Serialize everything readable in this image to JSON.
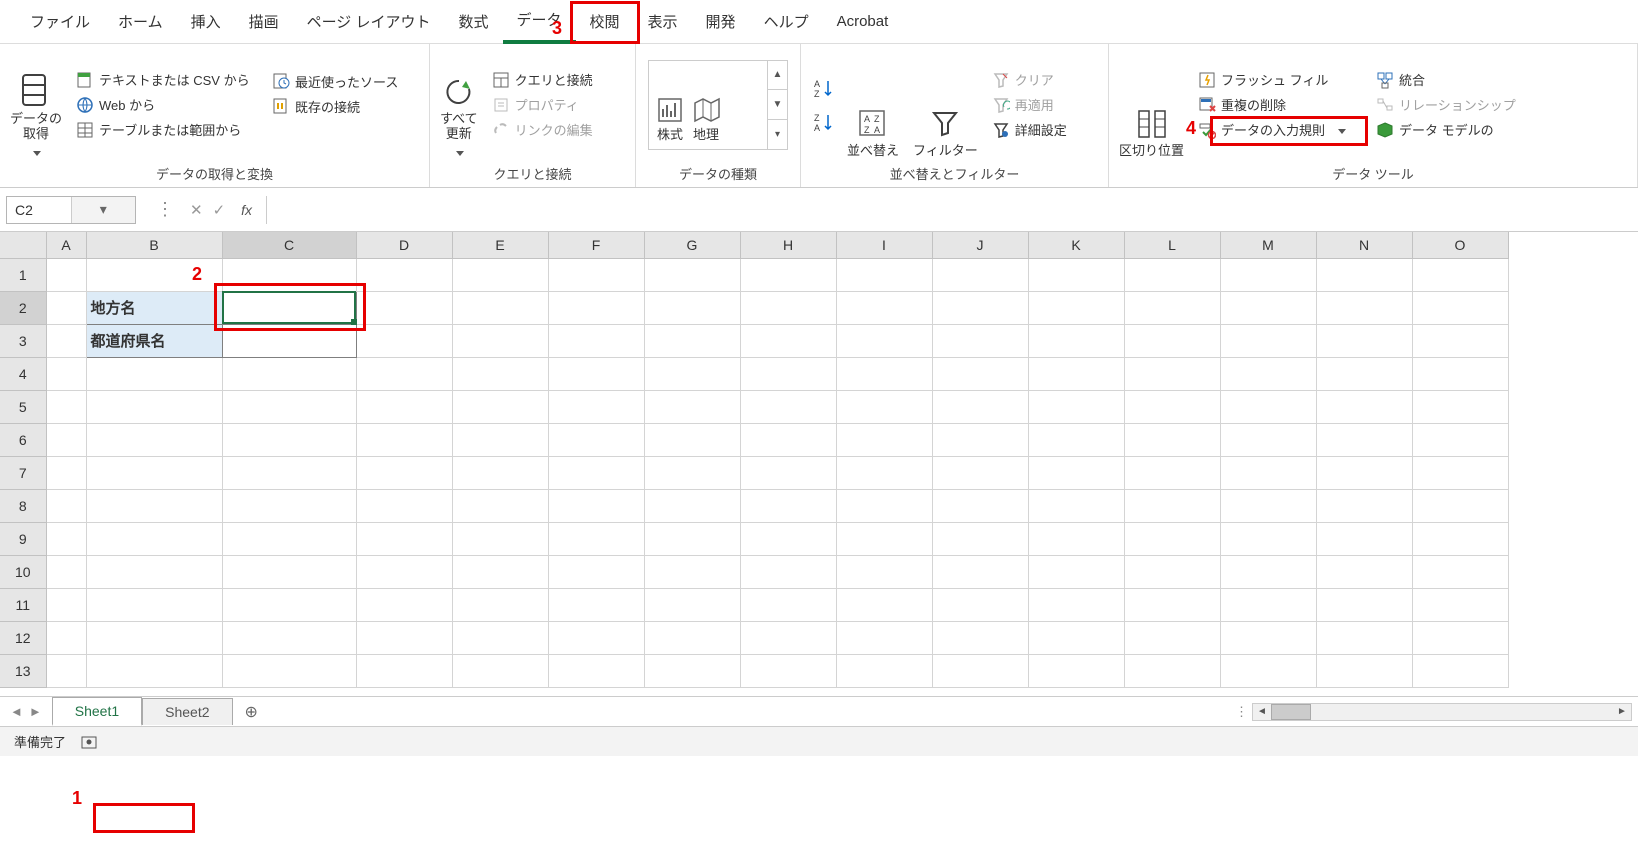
{
  "menu": [
    "ファイル",
    "ホーム",
    "挿入",
    "描画",
    "ページ レイアウト",
    "数式",
    "データ",
    "校閲",
    "表示",
    "開発",
    "ヘルプ",
    "Acrobat"
  ],
  "active_menu_index": 6,
  "ribbon": {
    "group1": {
      "label": "データの取得と変換",
      "data_get": "データの\n取得",
      "from_csv": "テキストまたは CSV から",
      "from_web": "Web から",
      "from_table": "テーブルまたは範囲から",
      "recent": "最近使ったソース",
      "existing": "既存の接続"
    },
    "group2": {
      "label": "クエリと接続",
      "refresh": "すべて\n更新",
      "queries": "クエリと接続",
      "properties": "プロパティ",
      "edit_links": "リンクの編集"
    },
    "group3": {
      "label": "データの種類",
      "stocks": "株式",
      "geo": "地理"
    },
    "group4": {
      "label": "並べ替えとフィルター",
      "sort": "並べ替え",
      "filter": "フィルター",
      "clear": "クリア",
      "reapply": "再適用",
      "advanced": "詳細設定"
    },
    "group5": {
      "label": "データ ツール",
      "text_to_col": "区切り位置",
      "flash_fill": "フラッシュ フィル",
      "remove_dup": "重複の削除",
      "validation": "データの入力規則",
      "consolidate": "統合",
      "relationships": "リレーションシップ",
      "data_model": "データ モデルの"
    }
  },
  "name_box": "C2",
  "fx_label": "fx",
  "columns": [
    "A",
    "B",
    "C",
    "D",
    "E",
    "F",
    "G",
    "H",
    "I",
    "J",
    "K",
    "L",
    "M",
    "N",
    "O"
  ],
  "rows": [
    1,
    2,
    3,
    4,
    5,
    6,
    7,
    8,
    9,
    10,
    11,
    12,
    13
  ],
  "cells": {
    "b2": "地方名",
    "b3": "都道府県名"
  },
  "sheets": {
    "s1": "Sheet1",
    "s2": "Sheet2"
  },
  "status": "準備完了",
  "callouts": {
    "c1": "1",
    "c2": "2",
    "c3": "3",
    "c4": "4"
  }
}
